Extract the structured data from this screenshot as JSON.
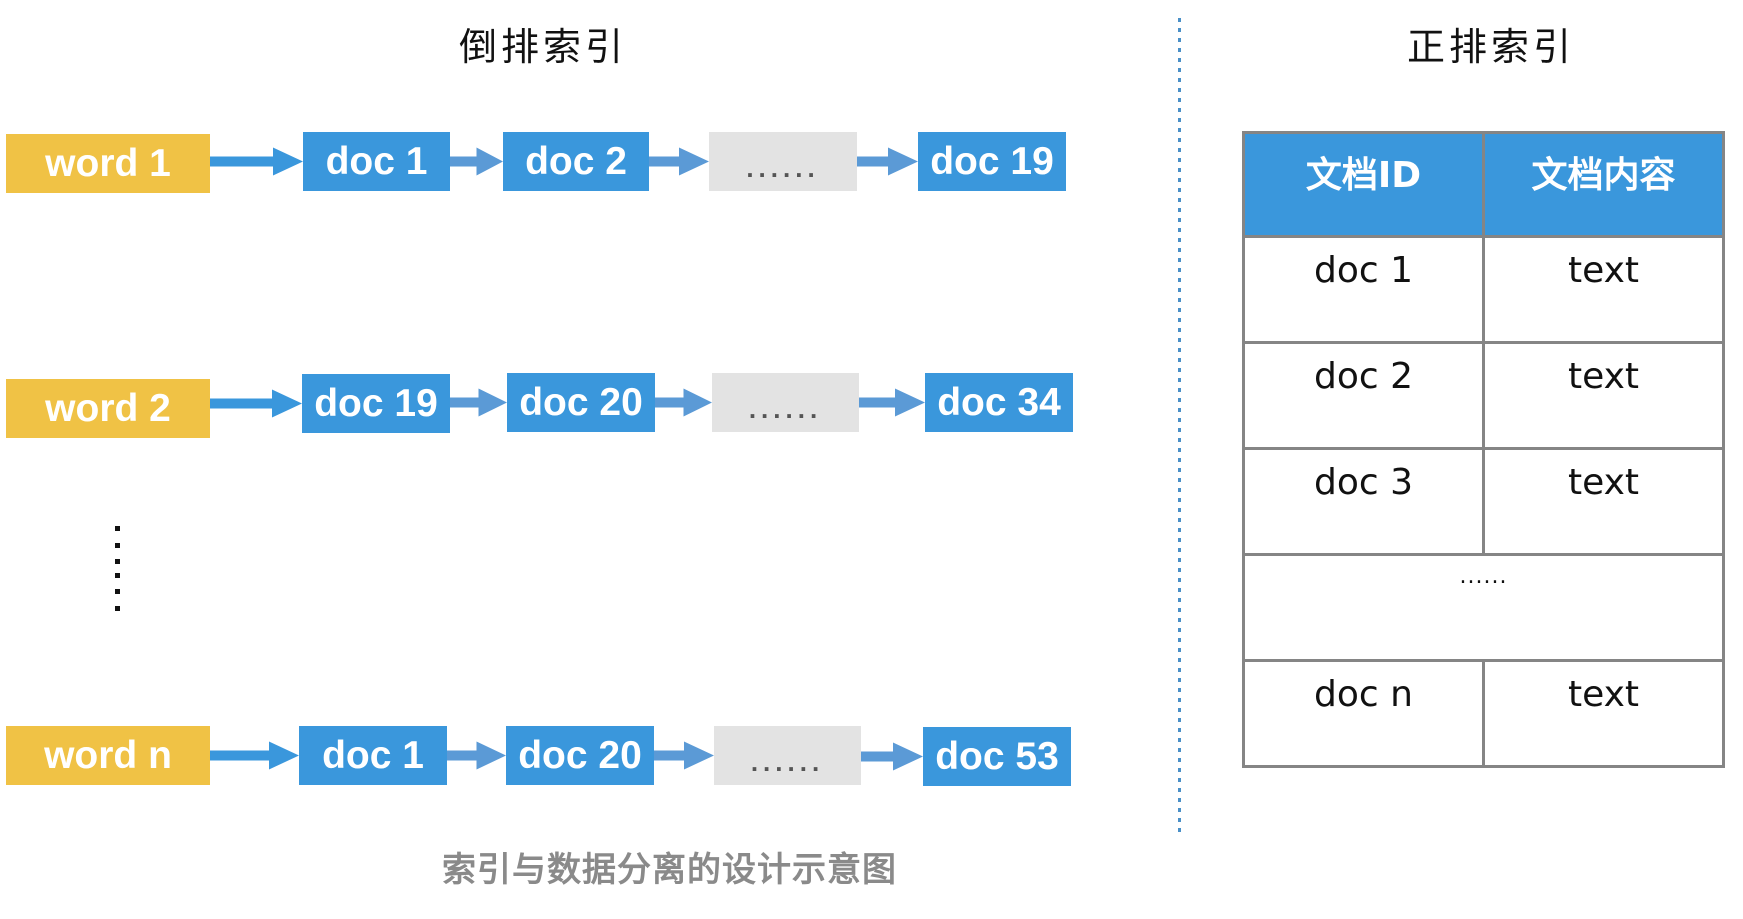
{
  "inverted_index": {
    "title": "倒排索引",
    "rows": [
      {
        "word": "word 1",
        "docs": [
          "doc 1",
          "doc 2",
          "......",
          "doc 19"
        ]
      },
      {
        "word": "word 2",
        "docs": [
          "doc 19",
          "doc 20",
          "......",
          "doc 34"
        ]
      },
      {
        "word": "word n",
        "docs": [
          "doc 1",
          "doc 20",
          "......",
          "doc 53"
        ]
      }
    ],
    "vertical_ellipsis": "......"
  },
  "forward_index": {
    "title": "正排索引",
    "columns": [
      "文档ID",
      "文档内容"
    ],
    "rows": [
      [
        "doc 1",
        "text"
      ],
      [
        "doc 2",
        "text"
      ],
      [
        "doc 3",
        "text"
      ],
      [
        "......"
      ],
      [
        "doc n",
        "text"
      ]
    ]
  },
  "caption": "索引与数据分离的设计示意图",
  "colors": {
    "word_box": "#f0c245",
    "doc_box": "#3a97dc",
    "ellipsis_box": "#e3e3e3",
    "arrow_primary": "#3a97dc",
    "arrow_secondary": "#5b9ad6",
    "table_header": "#3a97dc",
    "table_border": "#858585",
    "divider": "#4a90c8",
    "caption": "#8a8a8a"
  }
}
